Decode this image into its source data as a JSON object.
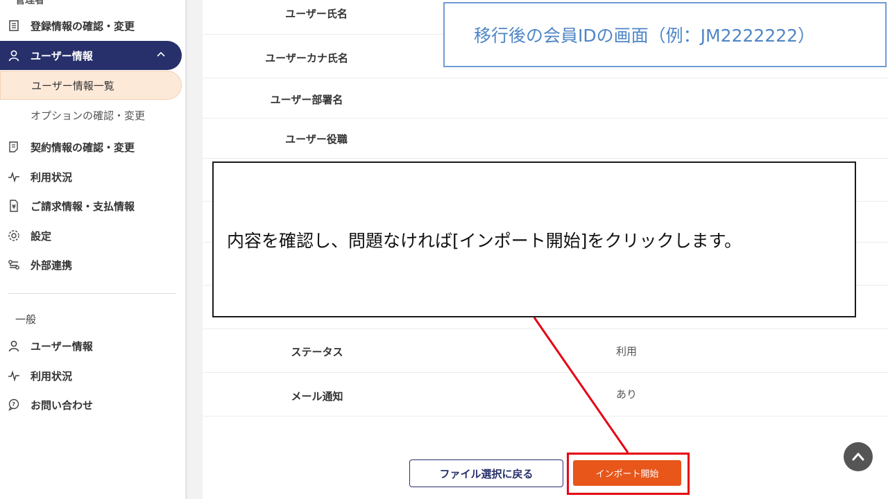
{
  "sidebar": {
    "cut_header": "管理者",
    "admin_items": [
      {
        "label": "登録情報の確認・変更",
        "icon": "building-icon"
      },
      {
        "label": "ユーザー情報",
        "icon": "user-icon"
      },
      {
        "label": "ユーザー情報一覧"
      },
      {
        "label": "オプションの確認・変更"
      },
      {
        "label": "契約情報の確認・変更",
        "icon": "document-icon"
      },
      {
        "label": "利用状況",
        "icon": "activity-icon"
      },
      {
        "label": "ご請求情報・支払情報",
        "icon": "invoice-icon"
      },
      {
        "label": "設定",
        "icon": "gear-icon"
      },
      {
        "label": "外部連携",
        "icon": "link-icon"
      }
    ],
    "general_section": "一般",
    "general_items": [
      {
        "label": "ユーザー情報",
        "icon": "user-icon"
      },
      {
        "label": "利用状況",
        "icon": "activity-icon"
      },
      {
        "label": "お問い合わせ",
        "icon": "chat-question-icon"
      }
    ]
  },
  "main": {
    "rows": [
      {
        "label": "ユーザー氏名",
        "value": ""
      },
      {
        "label": "ユーザーカナ氏名",
        "value": ""
      },
      {
        "label": "ユーザー部署名",
        "value": ""
      },
      {
        "label": "ユーザー役職",
        "value": ""
      },
      {
        "label": "ステータス",
        "value": "利用"
      },
      {
        "label": "メール通知",
        "value": "あり"
      }
    ],
    "back_button": "ファイル選択に戻る",
    "import_button": "インポート開始"
  },
  "annotations": {
    "id_note": "移行後の会員IDの画面（例：JM2222222）",
    "callout": "内容を確認し、問題なければ[インポート開始]をクリックします。"
  },
  "colors": {
    "nav_active": "#27306b",
    "sub_selected": "#fde9d8",
    "import_button": "#e8561a",
    "highlight": "#e60012",
    "id_note_text": "#4f86c6"
  }
}
